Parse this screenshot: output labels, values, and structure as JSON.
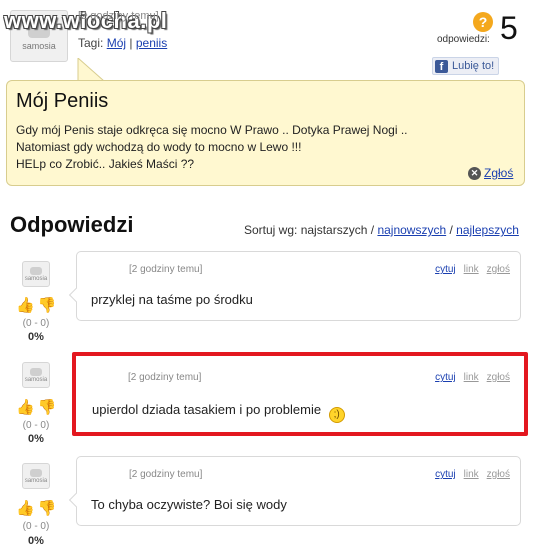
{
  "site": {
    "watermark": "www.wiocha.pl"
  },
  "question": {
    "avatar_label": "samosia",
    "time": "[2 godziny temu]",
    "tags_label": "Tagi:",
    "tags": [
      "Mój",
      "peniis"
    ],
    "tag_separator": "|",
    "answers_icon": "?",
    "answers_label": "odpowiedzi:",
    "answers_count": "5",
    "like_label": "Lubię to!",
    "title": "Mój Peniis",
    "body": "Gdy mój Penis staje odkręca się mocno W Prawo .. Dotyka Prawej Nogi ..\nNatomiast gdy wchodzą do wody to mocno w Lewo !!!\nHELp co Zrobić.. Jakieś Maści ??",
    "report_label": "Zgłoś"
  },
  "answers_section": {
    "title": "Odpowiedzi",
    "sort_label": "Sortuj wg:",
    "sort_current": "najstarszych",
    "sort_options": [
      "najnowszych",
      "najlepszych"
    ],
    "sort_separator": "/"
  },
  "answers": [
    {
      "avatar_label": "samosia",
      "score": "(0 - 0)",
      "percent": "0%",
      "time": "[2 godziny temu]",
      "cite": "cytuj",
      "link": "link",
      "report": "zgłoś",
      "text": "przyklej na taśme po środku",
      "highlighted": false
    },
    {
      "avatar_label": "samosia",
      "score": "(0 - 0)",
      "percent": "0%",
      "time": "[2 godziny temu]",
      "cite": "cytuj",
      "link": "link",
      "report": "zgłoś",
      "text": "upierdol dziada tasakiem i po problemie",
      "highlighted": true,
      "smiley": ";)"
    },
    {
      "avatar_label": "samosia",
      "score": "(0 - 0)",
      "percent": "0%",
      "time": "[2 godziny temu]",
      "cite": "cytuj",
      "link": "link",
      "report": "zgłoś",
      "text": "To chyba oczywiste? Boi się wody",
      "highlighted": false
    }
  ],
  "colors": {
    "question_bg": "#fff8d0",
    "highlight": "#e3171f",
    "link": "#1a3fb0",
    "thumb_up": "#d8357a",
    "thumb_down": "#e9a321",
    "answers_icon": "#f4a81d"
  }
}
